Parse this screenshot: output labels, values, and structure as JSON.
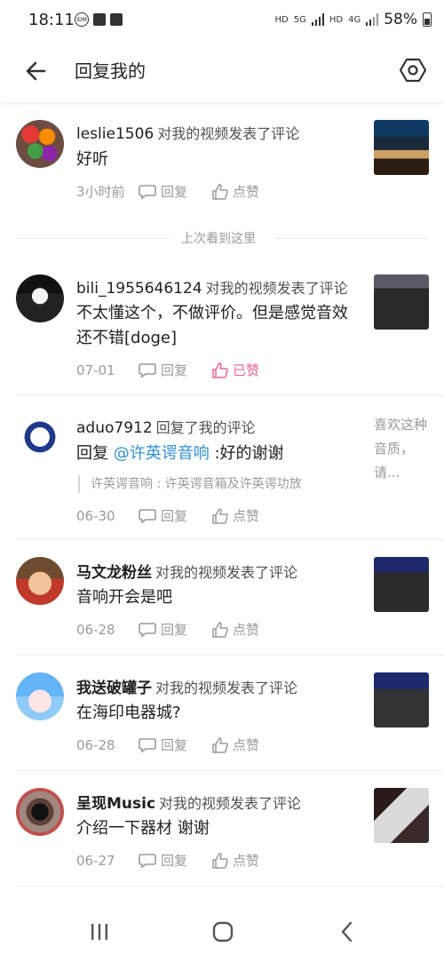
{
  "status": {
    "time": "18:11",
    "network_left": "HD",
    "network_5g": "5G",
    "network_hd2": "HD",
    "network_4g": "4G",
    "battery": "58%"
  },
  "header": {
    "title": "回复我的"
  },
  "last_seen_label": "上次看到这里",
  "actions": {
    "reply": "回复",
    "like": "点赞",
    "liked": "已赞"
  },
  "comments": [
    {
      "username": "leslie1506",
      "action": "对我的视频发表了评论",
      "content": "好听",
      "time": "3小时前",
      "liked": false
    },
    {
      "username": "bili_1955646124",
      "action": "对我的视频发表了评论",
      "content": "不太懂这个，不做评价。但是感觉音效还不错[doge]",
      "time": "07-01",
      "liked": true
    },
    {
      "username": "aduo7912",
      "action": "回复了我的评论",
      "content_prefix": "回复 ",
      "mention": "@许英谔音响",
      "content_suffix": " :好的谢谢",
      "quote": "许英谔音响 : 许英谔音箱及许英谔功放",
      "side_text": "喜欢这种音质，请...",
      "time": "06-30",
      "liked": false
    },
    {
      "username": "马文龙粉丝",
      "action": "对我的视频发表了评论",
      "content": "音响开会是吧",
      "time": "06-28",
      "liked": false
    },
    {
      "username": "我送破罐子",
      "action": "对我的视频发表了评论",
      "content": "在海印电器城?",
      "time": "06-28",
      "liked": false
    },
    {
      "username": "呈现Music",
      "action": "对我的视频发表了评论",
      "content": "介绍一下器材 谢谢",
      "time": "06-27",
      "liked": false
    }
  ],
  "colors": {
    "accent_pink": "#f06292",
    "mention_blue": "#2e8fd5",
    "meta_gray": "#9a9a9a"
  }
}
